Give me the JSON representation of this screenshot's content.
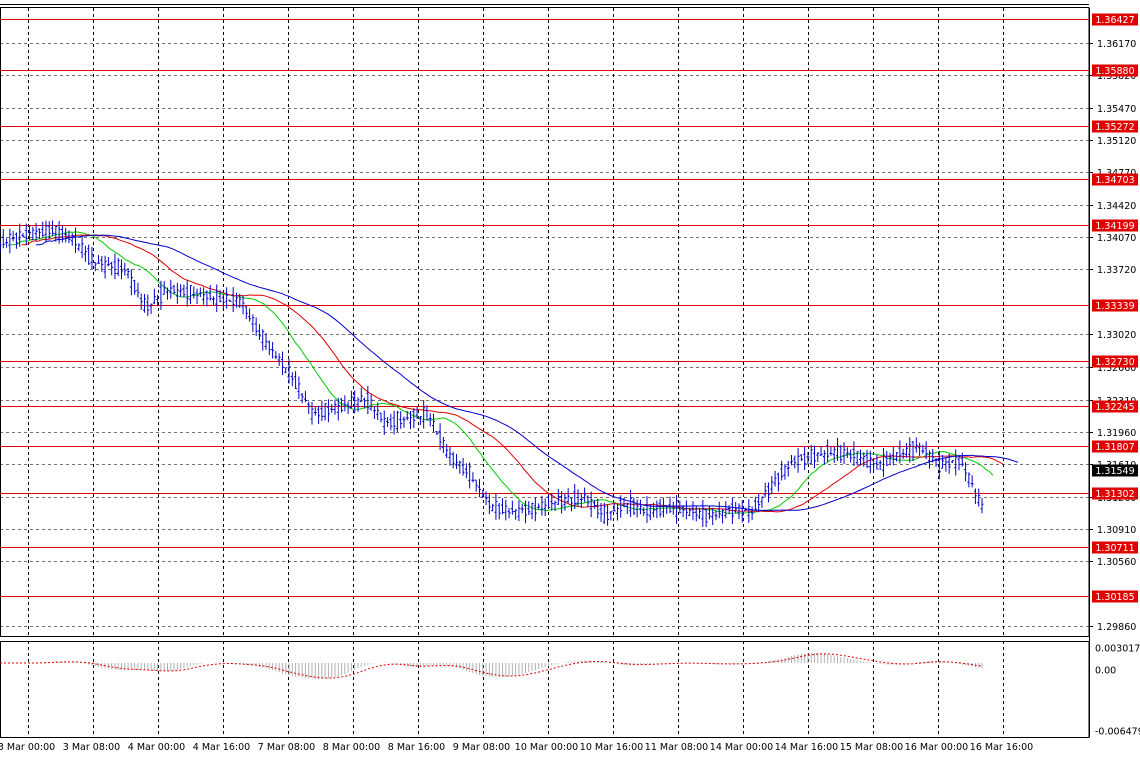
{
  "chart_data": {
    "type": "line",
    "symbol": "",
    "timeframe": "",
    "x_labels": [
      "3 Mar 00:00",
      "3 Mar 08:00",
      "4 Mar 00:00",
      "4 Mar 16:00",
      "7 Mar 08:00",
      "8 Mar 00:00",
      "8 Mar 16:00",
      "9 Mar 08:00",
      "10 Mar 00:00",
      "10 Mar 16:00",
      "11 Mar 08:00",
      "14 Mar 00:00",
      "14 Mar 16:00",
      "15 Mar 08:00",
      "16 Mar 00:00",
      "16 Mar 16:00"
    ],
    "y_ticks": [
      "1.36170",
      "1.35820",
      "1.35470",
      "1.35120",
      "1.34770",
      "1.34420",
      "1.34070",
      "1.33720",
      "1.33020",
      "1.32660",
      "1.32310",
      "1.31960",
      "1.31610",
      "1.31260",
      "1.30910",
      "1.30560",
      "1.29860"
    ],
    "ylim": [
      1.2975,
      1.3655
    ],
    "current_price": "1.31549",
    "levels": [
      {
        "value": "1.36427"
      },
      {
        "value": "1.35880"
      },
      {
        "value": "1.35272"
      },
      {
        "value": "1.34703"
      },
      {
        "value": "1.34199"
      },
      {
        "value": "1.33339"
      },
      {
        "value": "1.32730"
      },
      {
        "value": "1.32245"
      },
      {
        "value": "1.31807"
      },
      {
        "value": "1.31302"
      },
      {
        "value": "1.30711"
      },
      {
        "value": "1.30185"
      }
    ],
    "price_series": [
      {
        "t": 0,
        "o": 1.3405,
        "h": 1.3412,
        "l": 1.3395,
        "c": 1.34
      },
      {
        "t": 0.025,
        "o": 1.34,
        "h": 1.3415,
        "l": 1.339,
        "c": 1.341
      },
      {
        "t": 0.05,
        "o": 1.341,
        "h": 1.3425,
        "l": 1.3398,
        "c": 1.3415
      },
      {
        "t": 0.07,
        "o": 1.3415,
        "h": 1.3428,
        "l": 1.34,
        "c": 1.3405
      },
      {
        "t": 0.09,
        "o": 1.3405,
        "h": 1.341,
        "l": 1.337,
        "c": 1.338
      },
      {
        "t": 0.12,
        "o": 1.338,
        "h": 1.3392,
        "l": 1.3365,
        "c": 1.3372
      },
      {
        "t": 0.14,
        "o": 1.3372,
        "h": 1.338,
        "l": 1.332,
        "c": 1.333
      },
      {
        "t": 0.16,
        "o": 1.333,
        "h": 1.3365,
        "l": 1.3315,
        "c": 1.335
      },
      {
        "t": 0.19,
        "o": 1.335,
        "h": 1.3365,
        "l": 1.333,
        "c": 1.3345
      },
      {
        "t": 0.21,
        "o": 1.3345,
        "h": 1.3362,
        "l": 1.332,
        "c": 1.334
      },
      {
        "t": 0.23,
        "o": 1.334,
        "h": 1.335,
        "l": 1.332,
        "c": 1.3338
      },
      {
        "t": 0.25,
        "o": 1.3338,
        "h": 1.3345,
        "l": 1.329,
        "c": 1.33
      },
      {
        "t": 0.28,
        "o": 1.33,
        "h": 1.331,
        "l": 1.3245,
        "c": 1.3255
      },
      {
        "t": 0.3,
        "o": 1.3255,
        "h": 1.3265,
        "l": 1.32,
        "c": 1.3215
      },
      {
        "t": 0.33,
        "o": 1.3215,
        "h": 1.324,
        "l": 1.3195,
        "c": 1.3225
      },
      {
        "t": 0.35,
        "o": 1.3225,
        "h": 1.3245,
        "l": 1.321,
        "c": 1.3232
      },
      {
        "t": 0.37,
        "o": 1.3232,
        "h": 1.324,
        "l": 1.3195,
        "c": 1.3205
      },
      {
        "t": 0.39,
        "o": 1.3205,
        "h": 1.322,
        "l": 1.319,
        "c": 1.321
      },
      {
        "t": 0.41,
        "o": 1.321,
        "h": 1.3225,
        "l": 1.3195,
        "c": 1.3215
      },
      {
        "t": 0.43,
        "o": 1.3215,
        "h": 1.322,
        "l": 1.316,
        "c": 1.317
      },
      {
        "t": 0.45,
        "o": 1.317,
        "h": 1.3185,
        "l": 1.314,
        "c": 1.315
      },
      {
        "t": 0.47,
        "o": 1.315,
        "h": 1.3165,
        "l": 1.3105,
        "c": 1.3115
      },
      {
        "t": 0.49,
        "o": 1.3115,
        "h": 1.313,
        "l": 1.31,
        "c": 1.311
      },
      {
        "t": 0.51,
        "o": 1.311,
        "h": 1.3125,
        "l": 1.3102,
        "c": 1.3112
      },
      {
        "t": 0.53,
        "o": 1.3112,
        "h": 1.3128,
        "l": 1.3105,
        "c": 1.312
      },
      {
        "t": 0.56,
        "o": 1.312,
        "h": 1.3132,
        "l": 1.311,
        "c": 1.3125
      },
      {
        "t": 0.58,
        "o": 1.3125,
        "h": 1.3135,
        "l": 1.3095,
        "c": 1.3105
      },
      {
        "t": 0.6,
        "o": 1.3105,
        "h": 1.3125,
        "l": 1.3095,
        "c": 1.3118
      },
      {
        "t": 0.62,
        "o": 1.3118,
        "h": 1.3132,
        "l": 1.31,
        "c": 1.311
      },
      {
        "t": 0.64,
        "o": 1.311,
        "h": 1.3125,
        "l": 1.3098,
        "c": 1.3115
      },
      {
        "t": 0.66,
        "o": 1.3115,
        "h": 1.313,
        "l": 1.31,
        "c": 1.311
      },
      {
        "t": 0.68,
        "o": 1.311,
        "h": 1.3118,
        "l": 1.3096,
        "c": 1.3105
      },
      {
        "t": 0.7,
        "o": 1.3105,
        "h": 1.312,
        "l": 1.3098,
        "c": 1.3112
      },
      {
        "t": 0.72,
        "o": 1.3112,
        "h": 1.312,
        "l": 1.3102,
        "c": 1.311
      },
      {
        "t": 0.74,
        "o": 1.311,
        "h": 1.315,
        "l": 1.3105,
        "c": 1.314
      },
      {
        "t": 0.76,
        "o": 1.314,
        "h": 1.3175,
        "l": 1.313,
        "c": 1.3165
      },
      {
        "t": 0.78,
        "o": 1.3165,
        "h": 1.318,
        "l": 1.315,
        "c": 1.317
      },
      {
        "t": 0.8,
        "o": 1.317,
        "h": 1.3185,
        "l": 1.3158,
        "c": 1.3175
      },
      {
        "t": 0.82,
        "o": 1.3175,
        "h": 1.3188,
        "l": 1.316,
        "c": 1.317
      },
      {
        "t": 0.84,
        "o": 1.317,
        "h": 1.318,
        "l": 1.3148,
        "c": 1.316
      },
      {
        "t": 0.86,
        "o": 1.316,
        "h": 1.318,
        "l": 1.3152,
        "c": 1.3172
      },
      {
        "t": 0.88,
        "o": 1.3172,
        "h": 1.3192,
        "l": 1.3165,
        "c": 1.318
      },
      {
        "t": 0.9,
        "o": 1.318,
        "h": 1.3188,
        "l": 1.315,
        "c": 1.316
      },
      {
        "t": 0.92,
        "o": 1.316,
        "h": 1.3182,
        "l": 1.3148,
        "c": 1.3165
      },
      {
        "t": 0.94,
        "o": 1.3165,
        "h": 1.3175,
        "l": 1.3105,
        "c": 1.3115
      }
    ]
  }
}
